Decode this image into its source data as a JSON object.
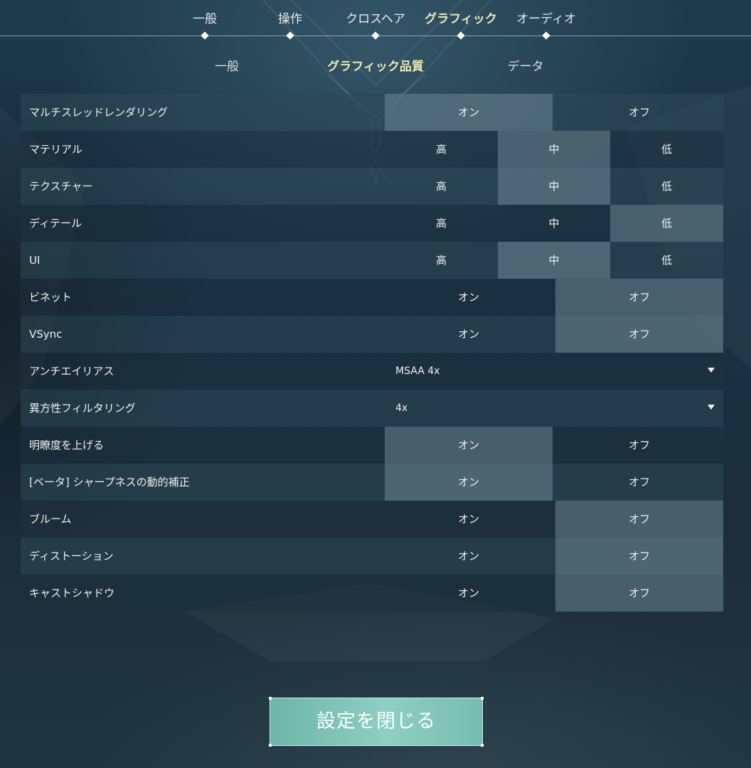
{
  "top_tabs": [
    {
      "label": "一般",
      "active": false
    },
    {
      "label": "操作",
      "active": false
    },
    {
      "label": "クロスヘア",
      "active": false
    },
    {
      "label": "グラフィック",
      "active": true
    },
    {
      "label": "オーディオ",
      "active": false
    }
  ],
  "sub_tabs": [
    {
      "label": "一般",
      "active": false
    },
    {
      "label": "グラフィック品質",
      "active": true
    },
    {
      "label": "データ",
      "active": false
    }
  ],
  "settings": [
    {
      "label": "マルチスレッドレンダリング",
      "type": "toggle",
      "options": [
        "オン",
        "オフ"
      ],
      "selected": "オン"
    },
    {
      "label": "マテリアル",
      "type": "triple",
      "options": [
        "高",
        "中",
        "低"
      ],
      "selected": "中"
    },
    {
      "label": "テクスチャー",
      "type": "triple",
      "options": [
        "高",
        "中",
        "低"
      ],
      "selected": "中"
    },
    {
      "label": "ディテール",
      "type": "triple",
      "options": [
        "高",
        "中",
        "低"
      ],
      "selected": "低"
    },
    {
      "label": "UI",
      "type": "triple",
      "options": [
        "高",
        "中",
        "低"
      ],
      "selected": "中"
    },
    {
      "label": "ビネット",
      "type": "toggle",
      "options": [
        "オン",
        "オフ"
      ],
      "selected": "オフ"
    },
    {
      "label": "VSync",
      "type": "toggle",
      "options": [
        "オン",
        "オフ"
      ],
      "selected": "オフ"
    },
    {
      "label": "アンチエイリアス",
      "type": "dropdown",
      "value": "MSAA 4x"
    },
    {
      "label": "異方性フィルタリング",
      "type": "dropdown",
      "value": "4x"
    },
    {
      "label": "明瞭度を上げる",
      "type": "toggle",
      "options": [
        "オン",
        "オフ"
      ],
      "selected": "オン"
    },
    {
      "label": "[ベータ] シャープネスの動的補正",
      "type": "toggle",
      "options": [
        "オン",
        "オフ"
      ],
      "selected": "オン"
    },
    {
      "label": "ブルーム",
      "type": "toggle",
      "options": [
        "オン",
        "オフ"
      ],
      "selected": "オフ"
    },
    {
      "label": "ディストーション",
      "type": "toggle",
      "options": [
        "オン",
        "オフ"
      ],
      "selected": "オフ"
    },
    {
      "label": "キャストシャドウ",
      "type": "toggle",
      "options": [
        "オン",
        "オフ"
      ],
      "selected": "オフ"
    }
  ],
  "close_button": {
    "label": "設定を閉じる"
  },
  "colors": {
    "accent_text": "#ece8b4",
    "button": "#8ecfc2",
    "selected_option": "#6e8791"
  }
}
